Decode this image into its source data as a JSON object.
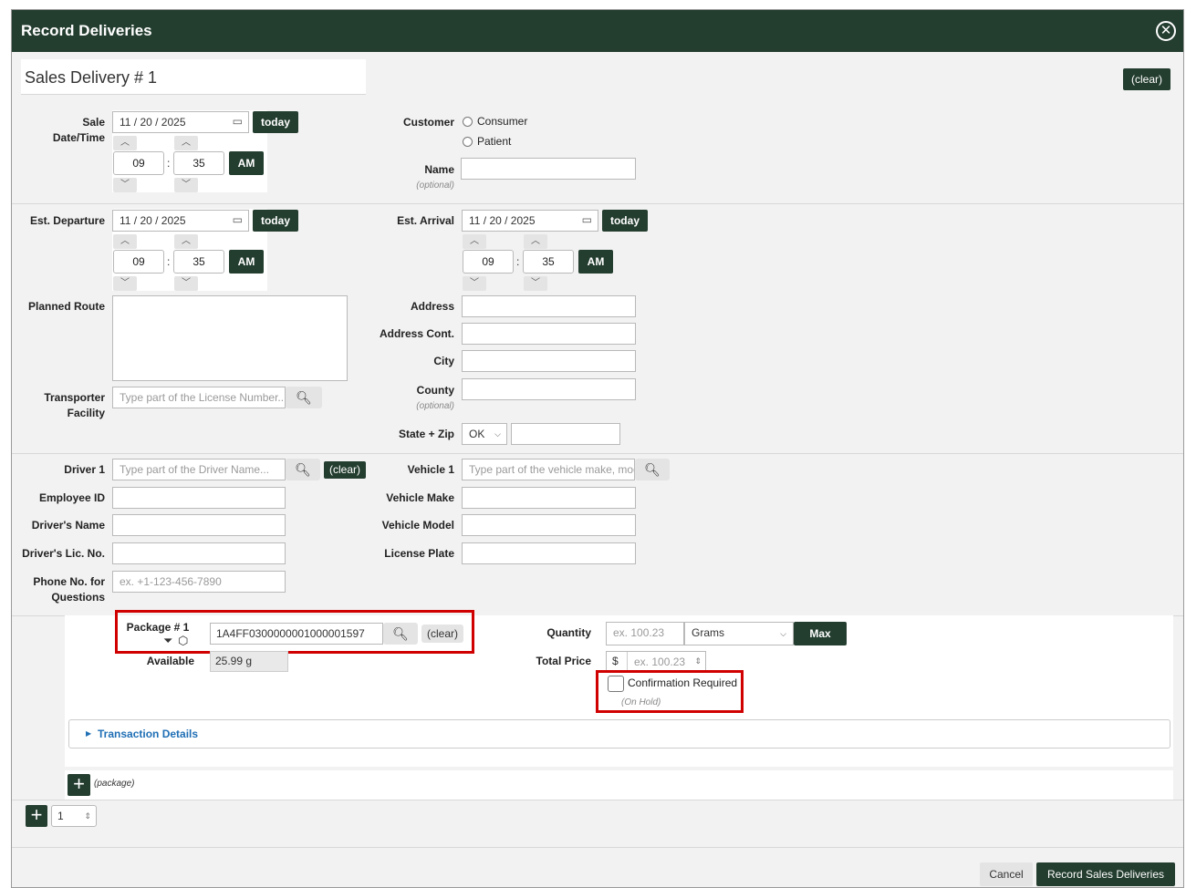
{
  "dialog": {
    "title": "Record Deliveries",
    "close_icon": "circle-x-icon"
  },
  "delivery": {
    "heading": "Sales Delivery # 1",
    "clear_label": "(clear)"
  },
  "sale": {
    "label_line1": "Sale",
    "label_line2": "Date/Time",
    "date": "11 / 20 / 2025",
    "today_label": "today",
    "hour": "09",
    "minute": "35",
    "ampm": "AM"
  },
  "customer": {
    "label": "Customer",
    "options": [
      "Consumer",
      "Patient"
    ],
    "name_label": "Name",
    "name_value": "",
    "optional": "(optional)"
  },
  "departure": {
    "label": "Est. Departure",
    "date": "11 / 20 / 2025",
    "today_label": "today",
    "hour": "09",
    "minute": "35",
    "ampm": "AM"
  },
  "arrival": {
    "label": "Est. Arrival",
    "date": "11 / 20 / 2025",
    "today_label": "today",
    "hour": "09",
    "minute": "35",
    "ampm": "AM"
  },
  "route": {
    "label": "Planned Route",
    "value": ""
  },
  "transporter": {
    "label_line1": "Transporter",
    "label_line2": "Facility",
    "placeholder": "Type part of the License Number..."
  },
  "address": {
    "address_label": "Address",
    "address_cont_label": "Address Cont.",
    "city_label": "City",
    "county_label": "County",
    "county_optional": "(optional)",
    "state_zip_label": "State + Zip",
    "state_value": "OK"
  },
  "driver": {
    "label": "Driver 1",
    "placeholder": "Type part of the Driver Name...",
    "clear_label": "(clear)",
    "employee_id_label": "Employee ID",
    "name_label": "Driver's Name",
    "lic_label": "Driver's Lic. No.",
    "phone_label_line1": "Phone No. for",
    "phone_label_line2": "Questions",
    "phone_placeholder": "ex. +1-123-456-7890"
  },
  "vehicle": {
    "label": "Vehicle 1",
    "placeholder": "Type part of the vehicle make, model...",
    "make_label": "Vehicle Make",
    "model_label": "Vehicle Model",
    "plate_label": "License Plate"
  },
  "package": {
    "label": "Package # 1",
    "tag": "1A4FF0300000001000001597",
    "clear_label": "(clear)",
    "available_label": "Available",
    "available_value": "25.99 g",
    "quantity_label": "Quantity",
    "quantity_placeholder": "ex. 100.23",
    "unit": "Grams",
    "max_label": "Max",
    "total_price_label": "Total Price",
    "currency": "$",
    "price_placeholder": "ex. 100.23",
    "confirm_label": "Confirmation Required",
    "on_hold": "(On Hold)",
    "transaction_details": "Transaction Details",
    "add_package_label": "(package)"
  },
  "deliveries_count": "1",
  "footer": {
    "cancel_label": "Cancel",
    "submit_label": "Record Sales Deliveries"
  },
  "colors": {
    "brand": "#233d2f",
    "highlight": "#d10000",
    "link": "#1f6fb5"
  }
}
